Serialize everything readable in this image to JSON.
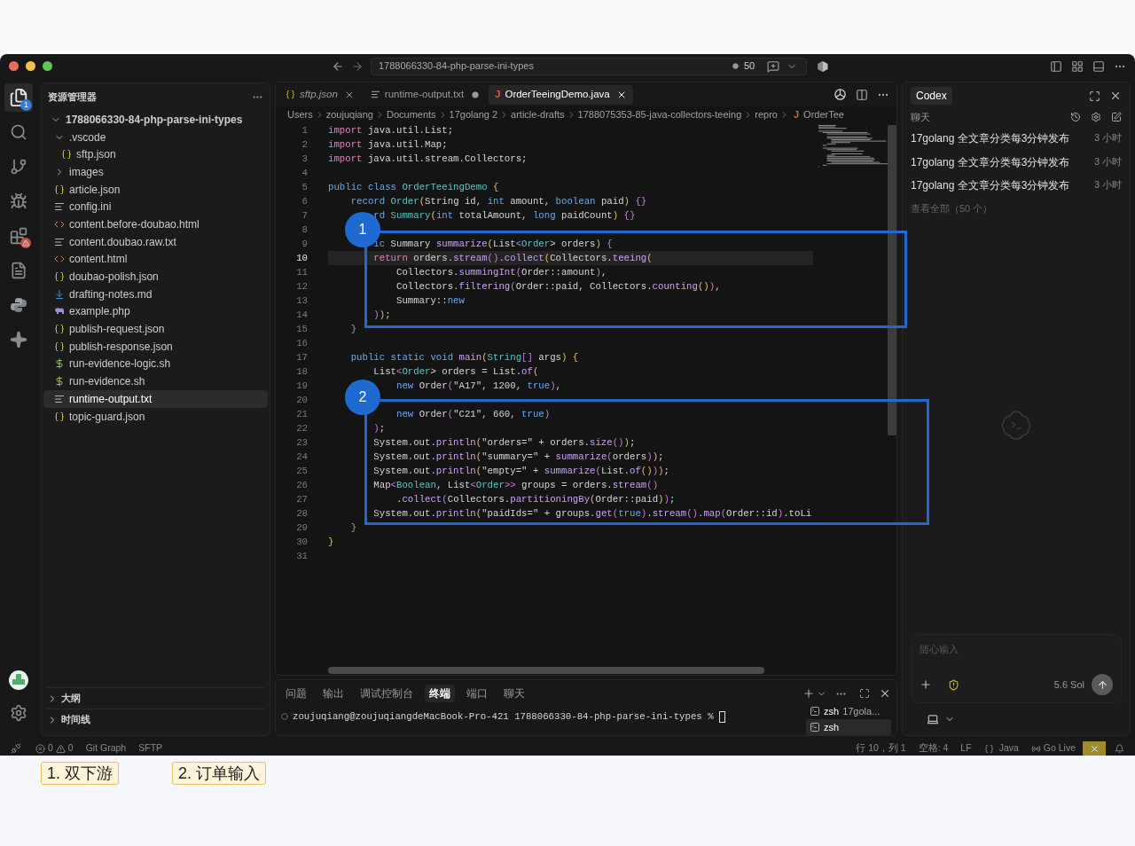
{
  "title_bar": {
    "search": "1788066330-84-php-parse-ini-types",
    "count": "50"
  },
  "activity_bar": {
    "items": [
      {
        "kind": "files",
        "selected": true,
        "badge": "1",
        "warning": false
      },
      {
        "kind": "search",
        "selected": false,
        "warning": false
      },
      {
        "kind": "branch",
        "selected": false,
        "warning": false
      },
      {
        "kind": "debug",
        "selected": false,
        "warning": false
      },
      {
        "kind": "extensions",
        "selected": false,
        "warning": true
      },
      {
        "kind": "cloud-doc",
        "selected": false,
        "warning": false
      },
      {
        "kind": "python",
        "selected": false,
        "warning": false
      },
      {
        "kind": "sparkle",
        "selected": false,
        "warning": false
      }
    ],
    "bottom": [
      {
        "kind": "account"
      },
      {
        "kind": "settings"
      }
    ]
  },
  "explorer": {
    "title": "资源管理器",
    "root": {
      "label": "1788066330-84-php-parse-ini-types",
      "kind": "folder",
      "expanded": true,
      "selected": false,
      "children": [
        {
          "label": ".vscode",
          "kind": "folder",
          "expanded": true,
          "selected": false,
          "children": [
            {
              "label": "sftp.json",
              "kind": "json",
              "selected": false
            }
          ]
        },
        {
          "label": "images",
          "kind": "folder",
          "expanded": false,
          "selected": false
        },
        {
          "label": "article.json",
          "kind": "json",
          "selected": false
        },
        {
          "label": "config.ini",
          "kind": "text",
          "selected": false
        },
        {
          "label": "content.before-doubao.html",
          "kind": "html",
          "selected": false
        },
        {
          "label": "content.doubao.raw.txt",
          "kind": "text",
          "selected": false
        },
        {
          "label": "content.html",
          "kind": "html",
          "selected": false
        },
        {
          "label": "doubao-polish.json",
          "kind": "json",
          "selected": false
        },
        {
          "label": "drafting-notes.md",
          "kind": "markdown",
          "selected": false
        },
        {
          "label": "example.php",
          "kind": "php",
          "selected": false
        },
        {
          "label": "publish-request.json",
          "kind": "json",
          "selected": false
        },
        {
          "label": "publish-response.json",
          "kind": "json",
          "selected": false
        },
        {
          "label": "run-evidence-logic.sh",
          "kind": "shell",
          "selected": false
        },
        {
          "label": "run-evidence.sh",
          "kind": "shell",
          "selected": false
        },
        {
          "label": "runtime-output.txt",
          "kind": "text",
          "selected": true
        },
        {
          "label": "topic-guard.json",
          "kind": "json",
          "selected": false
        }
      ]
    },
    "sections": [
      {
        "label": "大纲",
        "expanded": false
      },
      {
        "label": "时间线",
        "expanded": false
      }
    ]
  },
  "editor": {
    "tabs": [
      {
        "label": "sftp.json",
        "kind": "json",
        "selected": false,
        "preview": true,
        "modified": false
      },
      {
        "label": "runtime-output.txt",
        "kind": "text",
        "selected": false,
        "preview": false,
        "modified": true
      },
      {
        "label": "OrderTeeingDemo.java",
        "kind": "java",
        "icon": "J",
        "selected": true,
        "preview": false,
        "modified": false
      }
    ],
    "breadcrumb": [
      "Users",
      "zoujuqiang",
      "Documents",
      "17golang 2",
      "article-drafts",
      "1788075353-85-java-collectors-teeing",
      "repro"
    ],
    "breadcrumb_file": {
      "icon": "J",
      "label": "OrderTee"
    },
    "code": {
      "lines": [
        {
          "n": "1",
          "active": false,
          "segs": [
            {
              "text": "import",
              "kind": "k1"
            },
            {
              "text": " java.util.List;",
              "kind": "p"
            }
          ]
        },
        {
          "n": "2",
          "active": false,
          "segs": [
            {
              "text": "import",
              "kind": "k1"
            },
            {
              "text": " java.util.Map;",
              "kind": "p"
            }
          ]
        },
        {
          "n": "3",
          "active": false,
          "segs": [
            {
              "text": "import",
              "kind": "k1"
            },
            {
              "text": " java.util.stream.Collectors;",
              "kind": "p"
            }
          ]
        },
        {
          "n": "4",
          "active": false
        },
        {
          "n": "5",
          "active": false,
          "segs": [
            {
              "text": "public class ",
              "kind": "k2"
            },
            {
              "text": "OrderTeeingDemo ",
              "kind": "t"
            },
            {
              "text": "{",
              "kind": "b"
            }
          ]
        },
        {
          "n": "6",
          "active": false,
          "segs": [
            {
              "text": "    record ",
              "kind": "k2"
            },
            {
              "text": "Order",
              "kind": "t"
            },
            {
              "text": "(",
              "kind": "b"
            },
            {
              "text": "String id, ",
              "kind": "p"
            },
            {
              "text": "int",
              "kind": "k2"
            },
            {
              "text": " amount, ",
              "kind": "p"
            },
            {
              "text": "boolean",
              "kind": "k2"
            },
            {
              "text": " paid",
              "kind": "p"
            },
            {
              "text": ")",
              "kind": "b"
            },
            {
              "text": " {}",
              "kind": "b2"
            }
          ]
        },
        {
          "n": "7",
          "active": false,
          "segs": [
            {
              "text": "        rd ",
              "kind": "k2"
            },
            {
              "text": "Summary",
              "kind": "t"
            },
            {
              "text": "(",
              "kind": "b"
            },
            {
              "text": "int",
              "kind": "k2"
            },
            {
              "text": " totalAmount, ",
              "kind": "p"
            },
            {
              "text": "long",
              "kind": "k2"
            },
            {
              "text": " paidCount",
              "kind": "p"
            },
            {
              "text": ")",
              "kind": "b"
            },
            {
              "text": " {}",
              "kind": "b2"
            }
          ]
        },
        {
          "n": "8",
          "active": false
        },
        {
          "n": "9",
          "active": false,
          "segs": [
            {
              "text": "        ic ",
              "kind": "k2"
            },
            {
              "text": "Summary ",
              "kind": "p"
            },
            {
              "text": "summarize",
              "kind": "f"
            },
            {
              "text": "(",
              "kind": "b"
            },
            {
              "text": "List",
              "kind": "p"
            },
            {
              "text": "<",
              "kind": "b2"
            },
            {
              "text": "Order",
              "kind": "t"
            },
            {
              "text": "> orders",
              "kind": "p"
            },
            {
              "text": ")",
              "kind": "b"
            },
            {
              "text": " {",
              "kind": "b2"
            }
          ]
        },
        {
          "n": "10",
          "active": true,
          "segs": [
            {
              "text": "        return ",
              "kind": "k1"
            },
            {
              "text": "orders.",
              "kind": "p"
            },
            {
              "text": "stream",
              "kind": "f"
            },
            {
              "text": "()",
              "kind": "b2"
            },
            {
              "text": ".",
              "kind": "p"
            },
            {
              "text": "collect",
              "kind": "f"
            },
            {
              "text": "(",
              "kind": "b"
            },
            {
              "text": "Collectors.",
              "kind": "p"
            },
            {
              "text": "teeing",
              "kind": "f"
            },
            {
              "text": "(",
              "kind": "b"
            }
          ]
        },
        {
          "n": "11",
          "active": false,
          "segs": [
            {
              "text": "            Collectors.",
              "kind": "p"
            },
            {
              "text": "summingInt",
              "kind": "f"
            },
            {
              "text": "(",
              "kind": "b2"
            },
            {
              "text": "Order::amount",
              "kind": "p"
            },
            {
              "text": ")",
              "kind": "b2"
            },
            {
              "text": ",",
              "kind": "p"
            }
          ]
        },
        {
          "n": "12",
          "active": false,
          "segs": [
            {
              "text": "            Collectors.",
              "kind": "p"
            },
            {
              "text": "filtering",
              "kind": "f"
            },
            {
              "text": "(",
              "kind": "b2"
            },
            {
              "text": "Order::paid, Collectors.",
              "kind": "p"
            },
            {
              "text": "counting",
              "kind": "f"
            },
            {
              "text": "()",
              "kind": "b"
            },
            {
              "text": ")",
              "kind": "b2"
            },
            {
              "text": ",",
              "kind": "p"
            }
          ]
        },
        {
          "n": "13",
          "active": false,
          "segs": [
            {
              "text": "            Summary::",
              "kind": "p"
            },
            {
              "text": "new",
              "kind": "k2"
            }
          ]
        },
        {
          "n": "14",
          "active": false,
          "segs": [
            {
              "text": "        )",
              "kind": "b2"
            },
            {
              "text": ")",
              "kind": "b"
            },
            {
              "text": ";",
              "kind": "p"
            }
          ]
        },
        {
          "n": "15",
          "active": false,
          "segs": [
            {
              "text": "    }",
              "kind": "b2"
            }
          ]
        },
        {
          "n": "16",
          "active": false
        },
        {
          "n": "17",
          "active": false,
          "segs": [
            {
              "text": "    public static void ",
              "kind": "k2"
            },
            {
              "text": "main",
              "kind": "f"
            },
            {
              "text": "(",
              "kind": "b"
            },
            {
              "text": "String",
              "kind": "t"
            },
            {
              "text": "[] ",
              "kind": "b2"
            },
            {
              "text": "args",
              "kind": "p"
            },
            {
              "text": ")",
              "kind": "b"
            },
            {
              "text": " {",
              "kind": "b"
            }
          ]
        },
        {
          "n": "18",
          "active": false,
          "segs": [
            {
              "text": "        List",
              "kind": "p"
            },
            {
              "text": "<",
              "kind": "b2"
            },
            {
              "text": "Order",
              "kind": "t"
            },
            {
              "text": "> orders = List.",
              "kind": "p"
            },
            {
              "text": "of",
              "kind": "f"
            },
            {
              "text": "(",
              "kind": "b"
            }
          ]
        },
        {
          "n": "19",
          "active": false,
          "segs": [
            {
              "text": "            new ",
              "kind": "k2"
            },
            {
              "text": "Order",
              "kind": "p"
            },
            {
              "text": "(",
              "kind": "b2"
            },
            {
              "text": "\"A17\", 1200, ",
              "kind": "p"
            },
            {
              "text": "true",
              "kind": "k2"
            },
            {
              "text": ")",
              "kind": "b2"
            },
            {
              "text": ",",
              "kind": "p"
            }
          ]
        },
        {
          "n": "20",
          "active": false
        },
        {
          "n": "21",
          "active": false,
          "segs": [
            {
              "text": "            new ",
              "kind": "k2"
            },
            {
              "text": "Order",
              "kind": "p"
            },
            {
              "text": "(",
              "kind": "b2"
            },
            {
              "text": "\"C21\", 660, ",
              "kind": "p"
            },
            {
              "text": "true",
              "kind": "k2"
            },
            {
              "text": ")",
              "kind": "b2"
            }
          ]
        },
        {
          "n": "22",
          "active": false,
          "segs": [
            {
              "text": "        )",
              "kind": "b2"
            },
            {
              "text": ";",
              "kind": "p"
            }
          ]
        },
        {
          "n": "23",
          "active": false,
          "segs": [
            {
              "text": "        System.out.",
              "kind": "p"
            },
            {
              "text": "println",
              "kind": "f"
            },
            {
              "text": "(",
              "kind": "b"
            },
            {
              "text": "\"orders=\" + orders.",
              "kind": "p"
            },
            {
              "text": "size",
              "kind": "f"
            },
            {
              "text": "()",
              "kind": "b2"
            },
            {
              "text": ")",
              "kind": "b"
            },
            {
              "text": ";",
              "kind": "p"
            }
          ]
        },
        {
          "n": "24",
          "active": false,
          "segs": [
            {
              "text": "        System.out.",
              "kind": "p"
            },
            {
              "text": "println",
              "kind": "f"
            },
            {
              "text": "(",
              "kind": "b"
            },
            {
              "text": "\"summary=\" + ",
              "kind": "p"
            },
            {
              "text": "summarize",
              "kind": "f"
            },
            {
              "text": "(",
              "kind": "b2"
            },
            {
              "text": "orders",
              "kind": "p"
            },
            {
              "text": ")",
              "kind": "b2"
            },
            {
              "text": ")",
              "kind": "b"
            },
            {
              "text": ";",
              "kind": "p"
            }
          ]
        },
        {
          "n": "25",
          "active": false,
          "segs": [
            {
              "text": "        System.out.",
              "kind": "p"
            },
            {
              "text": "println",
              "kind": "f"
            },
            {
              "text": "(",
              "kind": "b"
            },
            {
              "text": "\"empty=\" + ",
              "kind": "p"
            },
            {
              "text": "summarize",
              "kind": "f"
            },
            {
              "text": "(",
              "kind": "b2"
            },
            {
              "text": "List.",
              "kind": "p"
            },
            {
              "text": "of",
              "kind": "f"
            },
            {
              "text": "()",
              "kind": "b"
            },
            {
              "text": ")",
              "kind": "b2"
            },
            {
              "text": ")",
              "kind": "b"
            },
            {
              "text": ";",
              "kind": "p"
            }
          ]
        },
        {
          "n": "26",
          "active": false,
          "segs": [
            {
              "text": "        Map",
              "kind": "p"
            },
            {
              "text": "<",
              "kind": "b2"
            },
            {
              "text": "Boolean",
              "kind": "t"
            },
            {
              "text": ", List",
              "kind": "p"
            },
            {
              "text": "<",
              "kind": "b2"
            },
            {
              "text": "Order",
              "kind": "t"
            },
            {
              "text": ">>",
              "kind": "b2"
            },
            {
              "text": " groups = orders.",
              "kind": "p"
            },
            {
              "text": "stream",
              "kind": "f"
            },
            {
              "text": "()",
              "kind": "b2"
            }
          ]
        },
        {
          "n": "27",
          "active": false,
          "segs": [
            {
              "text": "            .",
              "kind": "p"
            },
            {
              "text": "collect",
              "kind": "f"
            },
            {
              "text": "(",
              "kind": "b2"
            },
            {
              "text": "Collectors.",
              "kind": "p"
            },
            {
              "text": "partitioningBy",
              "kind": "f"
            },
            {
              "text": "(",
              "kind": "b"
            },
            {
              "text": "Order::paid",
              "kind": "p"
            },
            {
              "text": ")",
              "kind": "b"
            },
            {
              "text": ")",
              "kind": "b2"
            },
            {
              "text": ";",
              "kind": "p"
            }
          ]
        },
        {
          "n": "28",
          "active": false,
          "segs": [
            {
              "text": "        System.out.",
              "kind": "p"
            },
            {
              "text": "println",
              "kind": "f"
            },
            {
              "text": "(",
              "kind": "b"
            },
            {
              "text": "\"paidIds=\" + groups.",
              "kind": "p"
            },
            {
              "text": "get",
              "kind": "f"
            },
            {
              "text": "(",
              "kind": "b2"
            },
            {
              "text": "true",
              "kind": "k2"
            },
            {
              "text": ")",
              "kind": "b2"
            },
            {
              "text": ".",
              "kind": "p"
            },
            {
              "text": "stream",
              "kind": "f"
            },
            {
              "text": "()",
              "kind": "b2"
            },
            {
              "text": ".",
              "kind": "p"
            },
            {
              "text": "map",
              "kind": "f"
            },
            {
              "text": "(",
              "kind": "b2"
            },
            {
              "text": "Order::id",
              "kind": "p"
            },
            {
              "text": ")",
              "kind": "b2"
            },
            {
              "text": ".toLi",
              "kind": "p"
            }
          ]
        },
        {
          "n": "29",
          "active": false,
          "segs": [
            {
              "text": "    }",
              "kind": "b2"
            }
          ]
        },
        {
          "n": "30",
          "active": false,
          "segs": [
            {
              "text": "}",
              "kind": "b"
            }
          ]
        },
        {
          "n": "31",
          "active": false
        }
      ]
    }
  },
  "annotations": [
    {
      "label": "1"
    },
    {
      "label": "2"
    }
  ],
  "panel": {
    "tabs": [
      {
        "label": "问题",
        "selected": false
      },
      {
        "label": "输出",
        "selected": false
      },
      {
        "label": "调试控制台",
        "selected": false
      },
      {
        "label": "终端",
        "selected": true
      },
      {
        "label": "端口",
        "selected": false
      },
      {
        "label": "聊天",
        "selected": false
      }
    ],
    "terminal_line": "zoujuqiang@zoujuqiangdeMacBook-Pro-421 1788066330-84-php-parse-ini-types %",
    "terminals": [
      {
        "name": "zsh",
        "detail": "17gola...",
        "selected": false
      },
      {
        "name": "zsh",
        "selected": true
      }
    ]
  },
  "codex": {
    "tab": "Codex",
    "section": "聊天",
    "threads": [
      {
        "title": "17golang 全文章分类每3分钟发布",
        "time": "3 小时"
      },
      {
        "title": "17golang 全文章分类每3分钟发布",
        "time": "3 小时"
      },
      {
        "title": "17golang 全文章分类每3分钟发布",
        "time": "3 小时"
      }
    ],
    "view_all": "查看全部（50 个）",
    "input": {
      "placeholder": "随心输入"
    },
    "model": "5.6 Sol"
  },
  "status_bar": {
    "errors": "0",
    "warnings": "0",
    "left": [
      "Git Graph",
      "SFTP"
    ],
    "position": "行 10，列 1",
    "indent": "空格: 4",
    "eol": "LF",
    "language": "Java",
    "live": "Go Live"
  },
  "captions": [
    "1. 双下游",
    "2. 订单输入"
  ]
}
